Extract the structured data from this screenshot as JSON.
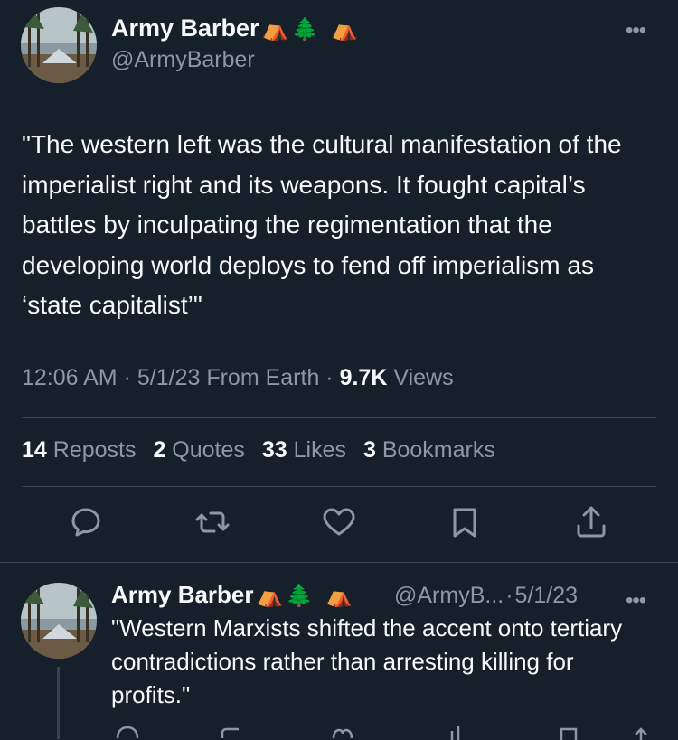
{
  "main_tweet": {
    "author": {
      "display_name": "Army Barber",
      "emojis": [
        "⛺",
        "🌲",
        "⛺"
      ],
      "handle": "@ArmyBarber"
    },
    "more_label": "•••",
    "text": "\"The western left was the cultural manifestation of the imperialist right and its weapons. It fought capital’s battles by inculpating the regimentation that the developing world deploys to fend off imperialism as ‘state capitalist’\"",
    "time": "12:06 AM",
    "date": "5/1/23",
    "source": "From Earth",
    "views_count": "9.7K",
    "views_label": "Views",
    "stats": {
      "reposts": {
        "count": "14",
        "label": "Reposts"
      },
      "quotes": {
        "count": "2",
        "label": "Quotes"
      },
      "likes": {
        "count": "33",
        "label": "Likes"
      },
      "bookmarks": {
        "count": "3",
        "label": "Bookmarks"
      }
    },
    "actions": [
      "reply-icon",
      "repost-icon",
      "like-icon",
      "bookmark-icon",
      "share-icon"
    ]
  },
  "reply_tweet": {
    "author": {
      "display_name": "Army Barber",
      "emojis": [
        "⛺",
        "🌲",
        "⛺"
      ],
      "handle": "@ArmyB...",
      "separator": "·",
      "date": "5/1/23"
    },
    "more_label": "•••",
    "text": "\"Western Marxists shifted the accent onto tertiary contradictions rather than arresting killing for profits.\""
  },
  "colors": {
    "background": "#15202b",
    "text_primary": "#f7f9f9",
    "text_secondary": "#8b98a5",
    "divider": "#38444d"
  }
}
